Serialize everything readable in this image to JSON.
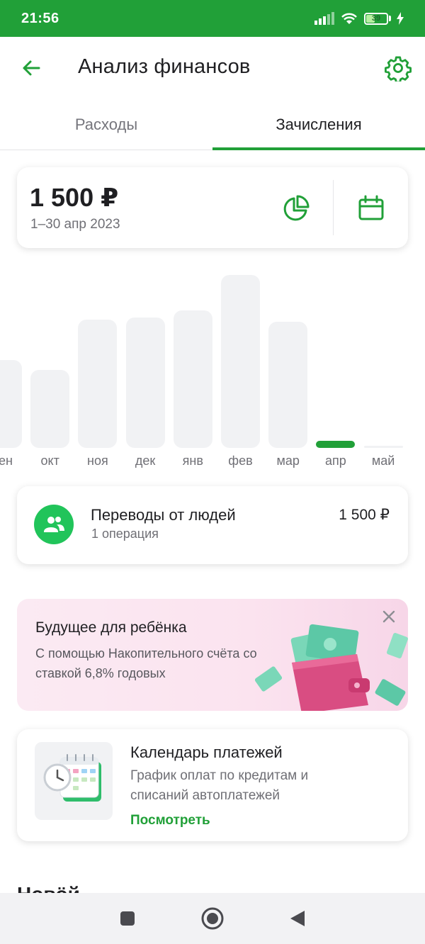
{
  "status_bar": {
    "time": "21:56",
    "battery": "39"
  },
  "header": {
    "title": "Анализ финансов"
  },
  "tabs": [
    {
      "label": "Расходы",
      "active": false
    },
    {
      "label": "Зачисления",
      "active": true
    }
  ],
  "summary": {
    "amount": "1 500 ₽",
    "period": "1–30 апр 2023"
  },
  "chart_data": {
    "type": "bar",
    "categories": [
      "сен",
      "окт",
      "ноя",
      "дек",
      "янв",
      "фев",
      "мар",
      "апр",
      "май"
    ],
    "values": [
      124,
      110,
      181,
      184,
      194,
      244,
      178,
      10,
      2
    ],
    "highlighted": "апр"
  },
  "transfer": {
    "title": "Переводы от людей",
    "subtitle": "1 операция",
    "amount": "1 500 ₽"
  },
  "promo": {
    "title": "Будущее для ребёнка",
    "text": "С помощью Накопительного счёта со ставкой 6,8% годовых"
  },
  "calendar_card": {
    "title": "Календарь платежей",
    "text": "График оплат по кредитам и списаний автоплатежей",
    "link": "Посмотреть"
  },
  "partial_heading": "Новӧй",
  "colors": {
    "accent": "#21a038",
    "bar": "#f1f2f4",
    "promo_bg": "#fbe3ef"
  }
}
